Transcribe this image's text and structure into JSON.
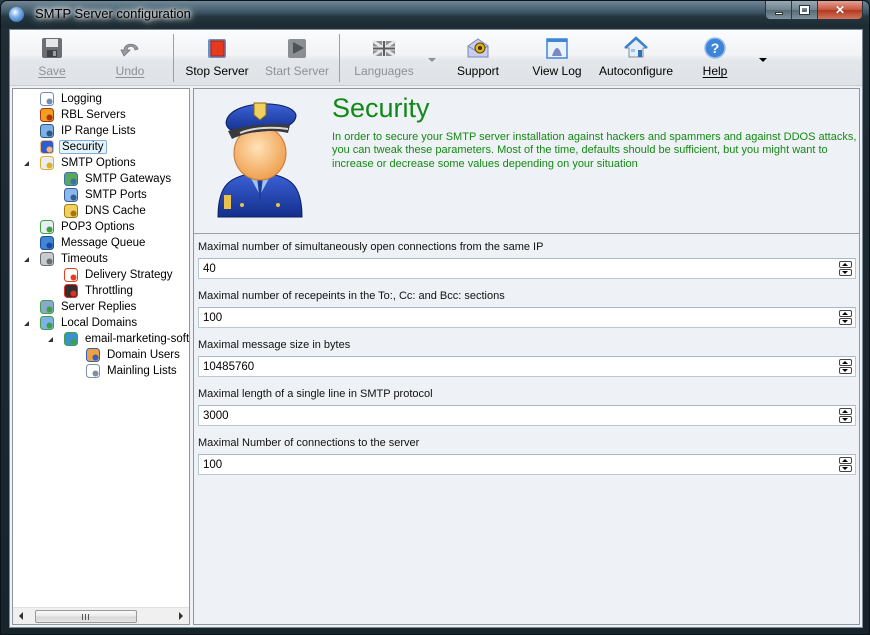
{
  "window": {
    "title": "SMTP Server configuration",
    "controls": {
      "minimize": "minimize",
      "maximize": "maximize",
      "close": "close"
    }
  },
  "toolbar": {
    "buttons": [
      {
        "id": "save",
        "label": "Save",
        "icon": "floppy-disk-icon",
        "enabled": false
      },
      {
        "id": "undo",
        "label": "Undo",
        "icon": "undo-arrow-icon",
        "enabled": false
      },
      {
        "id": "stop_server",
        "label": "Stop Server",
        "icon": "stop-server-icon",
        "enabled": true
      },
      {
        "id": "start_server",
        "label": "Start Server",
        "icon": "start-server-icon",
        "enabled": false
      },
      {
        "id": "languages",
        "label": "Languages",
        "icon": "uk-flag-icon",
        "enabled": false
      },
      {
        "id": "support",
        "label": "Support",
        "icon": "support-envelope-bug-icon",
        "enabled": true
      },
      {
        "id": "view_log",
        "label": "View Log",
        "icon": "view-log-window-icon",
        "enabled": true
      },
      {
        "id": "autoconfigure",
        "label": "Autoconfigure",
        "icon": "house-icon",
        "enabled": true
      },
      {
        "id": "help",
        "label": "Help",
        "icon": "help-question-icon",
        "enabled": true
      }
    ]
  },
  "tree": {
    "items": [
      {
        "label": "Logging",
        "icon": "log-document-icon",
        "level": 0
      },
      {
        "label": "RBL Servers",
        "icon": "spam-database-icon",
        "level": 0
      },
      {
        "label": "IP Range Lists",
        "icon": "network-computers-icon",
        "level": 0
      },
      {
        "label": "Security",
        "icon": "police-officer-icon",
        "level": 0,
        "selected": true
      },
      {
        "label": "SMTP Options",
        "icon": "locked-envelope-icon",
        "level": 0,
        "expanded": true
      },
      {
        "label": "SMTP Gateways",
        "icon": "gateway-icon",
        "level": 1
      },
      {
        "label": "SMTP Ports",
        "icon": "network-ports-icon",
        "level": 1
      },
      {
        "label": "DNS Cache",
        "icon": "cache-jar-icon",
        "level": 1
      },
      {
        "label": "POP3 Options",
        "icon": "pop3-envelope-icon",
        "level": 0
      },
      {
        "label": "Message Queue",
        "icon": "message-queue-icon",
        "level": 0
      },
      {
        "label": "Timeouts",
        "icon": "timeouts-icon",
        "level": 0,
        "expanded": true
      },
      {
        "label": "Delivery Strategy",
        "icon": "calendar-icon",
        "level": 1
      },
      {
        "label": "Throttling",
        "icon": "traffic-light-icon",
        "level": 1
      },
      {
        "label": "Server Replies",
        "icon": "server-replies-icon",
        "level": 0
      },
      {
        "label": "Local Domains",
        "icon": "local-domains-icon",
        "level": 0,
        "expanded": true
      },
      {
        "label": "email-marketing-softw",
        "icon": "globe-icon",
        "level": 1,
        "expanded": true
      },
      {
        "label": "Domain Users",
        "icon": "users-icon",
        "level": 2
      },
      {
        "label": "Mainling Lists",
        "icon": "mailing-list-icon",
        "level": 2
      }
    ]
  },
  "page": {
    "title": "Security",
    "description": "In order to secure your SMTP server installation against hackers and spammers and against DDOS attacks, you can tweak these parameters. Most of the time, defaults should be sufficient, but you might want to increase or decrease some values depending on your situation",
    "fields": [
      {
        "label": "Maximal number of simultaneously open connections from the same IP",
        "value": "40"
      },
      {
        "label": "Maximal number of recepeints in the To:, Cc: and Bcc: sections",
        "value": "100"
      },
      {
        "label": "Maximal message size in bytes",
        "value": "10485760"
      },
      {
        "label": "Maximal length of a single line in SMTP protocol",
        "value": "3000"
      },
      {
        "label": "Maximal Number of connections to the server",
        "value": "100"
      }
    ]
  },
  "colors": {
    "title_green": "#12881a",
    "description_green": "#148a14",
    "selection_border": "#84acdd",
    "selection_fill": "#e5f3fb"
  }
}
